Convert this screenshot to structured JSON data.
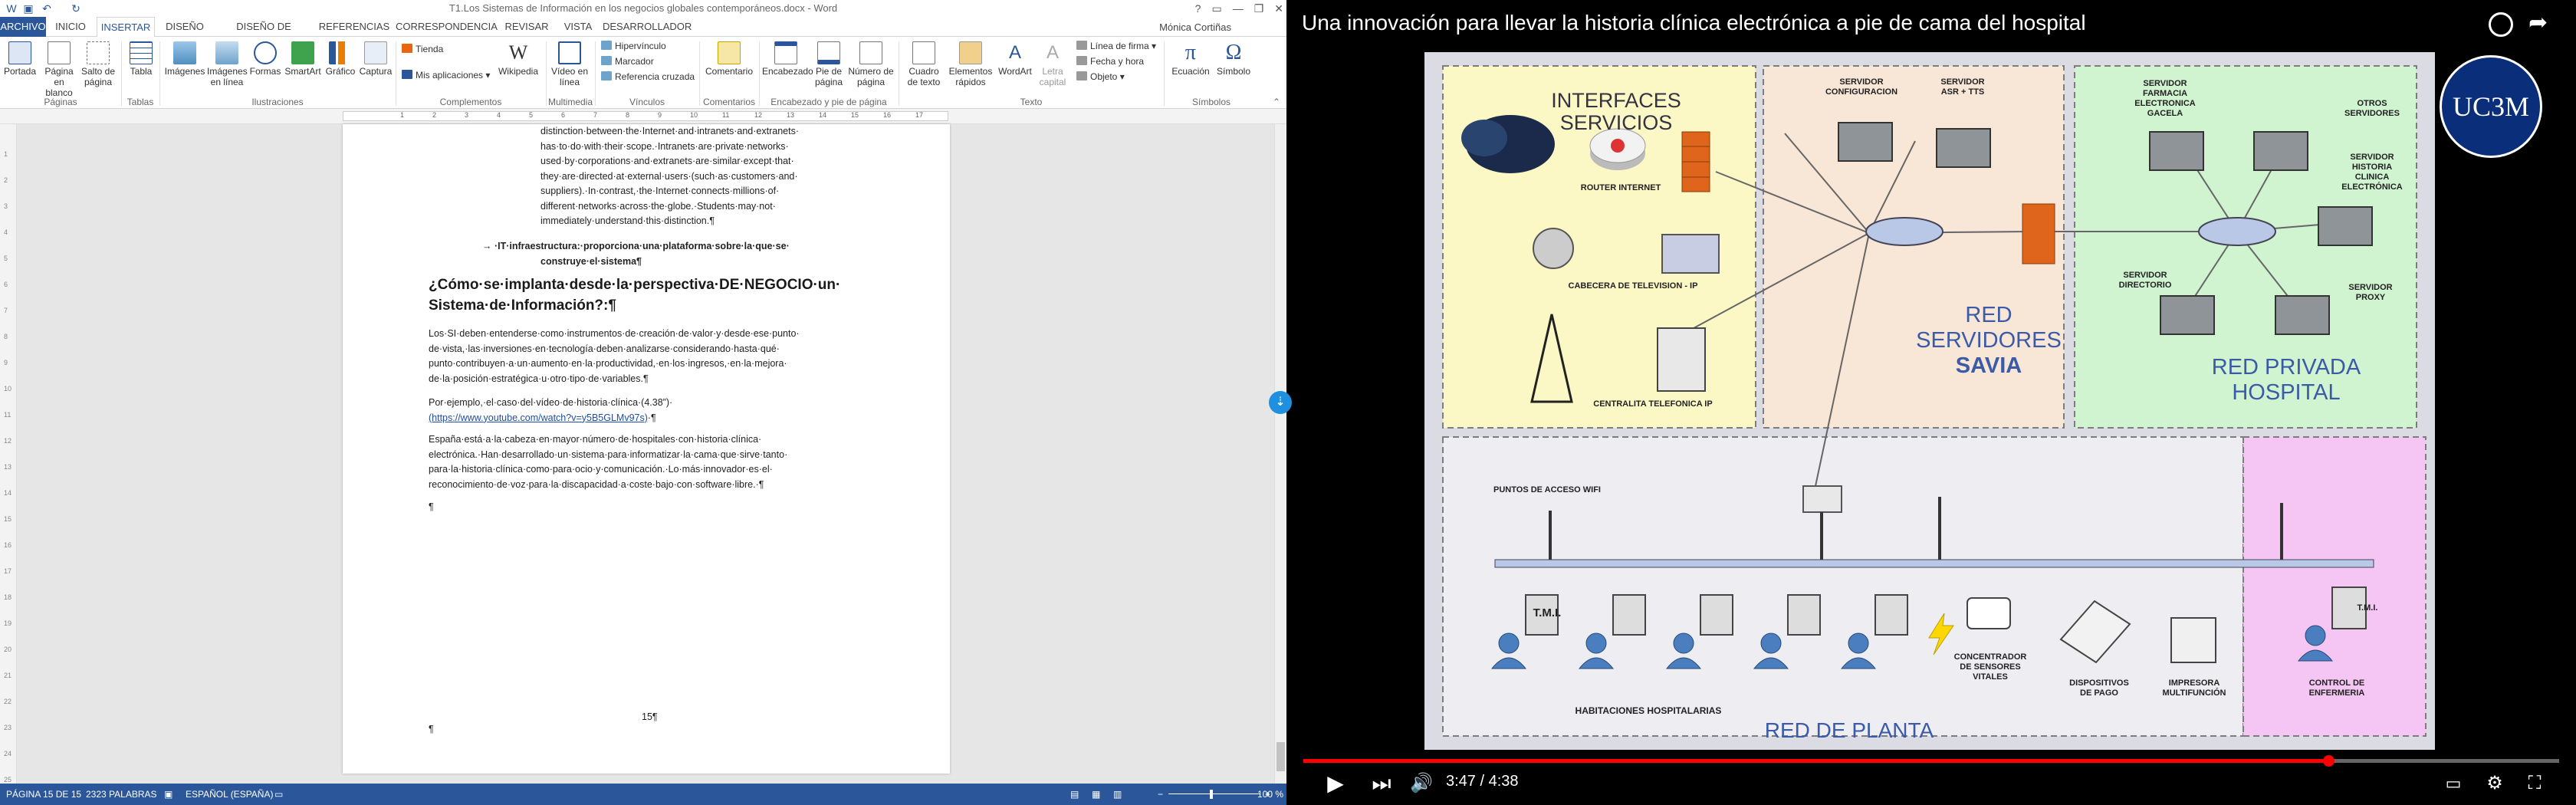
{
  "word": {
    "title": "T1.Los Sistemas de Información en los negocios globales contemporáneos.docx - Word",
    "user": "Mónica Cortiñas",
    "tabs": [
      "ARCHIVO",
      "INICIO",
      "INSERTAR",
      "DISEÑO",
      "DISEÑO DE PÁGINA",
      "REFERENCIAS",
      "CORRESPONDENCIA",
      "REVISAR",
      "VISTA",
      "DESARROLLADOR"
    ],
    "active_tab": "INSERTAR",
    "ribbon": {
      "portada": "Portada",
      "pagina_blanco": "Página en blanco",
      "salto_pagina": "Salto de página",
      "tabla": "Tabla",
      "imagenes": "Imágenes",
      "imagenes_linea": "Imágenes en línea",
      "formas": "Formas",
      "smartart": "SmartArt",
      "grafico": "Gráfico",
      "captura": "Captura",
      "tienda": "Tienda",
      "mis_aplicaciones": "Mis aplicaciones",
      "wikipedia": "Wikipedia",
      "video": "Vídeo en línea",
      "hipervinculo": "Hipervínculo",
      "marcador": "Marcador",
      "ref_cruzada": "Referencia cruzada",
      "comentario": "Comentario",
      "encabezado": "Encabezado",
      "pie_pagina": "Pie de página",
      "numero_pagina": "Número de página",
      "cuadro_texto": "Cuadro de texto",
      "elementos_rapidos": "Elementos rápidos",
      "wordart": "WordArt",
      "letra_capital": "Letra capital",
      "linea_firma": "Línea de firma",
      "fecha_hora": "Fecha y hora",
      "objeto": "Objeto",
      "ecuacion": "Ecuación",
      "simbolo": "Símbolo"
    },
    "groups": [
      "Páginas",
      "Tablas",
      "Ilustraciones",
      "Complementos",
      "Multimedia",
      "Vínculos",
      "Comentarios",
      "Encabezado y pie de página",
      "Texto",
      "Símbolos"
    ],
    "doc": {
      "p1": [
        "distinction·between·the·Internet·and·intranets·and·extranets·",
        "has·to·do·with·their·scope.·Intranets·are·private·networks·",
        "used·by·corporations·and·extranets·are·similar·except·that·",
        "they·are·directed·at·external·users·(such·as·customers·and·",
        "suppliers).·In·contrast,·the·Internet·connects·millions·of·",
        "different·networks·across·the·globe.·Students·may·not·",
        "immediately·understand·this·distinction.¶"
      ],
      "bullet": [
        "→ ·IT·infraestructura:·proporciona·una·plataforma·sobre·la·que·se·",
        "construye·el·sistema¶"
      ],
      "heading": [
        "¿Cómo·se·implanta·desde·la·perspectiva·DE·NEGOCIO·un·",
        "Sistema·de·Información?:¶"
      ],
      "p2": [
        "Los·SI·deben·entenderse·como·instrumentos·de·creación·de·valor·y·desde·ese·punto·",
        "de·vista,·las·inversiones·en·tecnología·deben·analizarse·considerando·hasta·qué·",
        "punto·contribuyen·a·un·aumento·en·la·productividad,·en·los·ingresos,·en·la·mejora·",
        "de·la·posición·estratégica·u·otro·tipo·de·variables.¶"
      ],
      "p3a": "Por·ejemplo,·el·caso·del·vídeo·de·historia·clínica·(4.38”)·",
      "p3link": "(https://www.youtube.com/watch?v=y5B5GLMv97s)",
      "p3end": "·¶",
      "p4": [
        "España·está·a·la·cabeza·en·mayor·número·de·hospitales·con·historia·clínica·",
        "electrónica.·Han·desarrollado·un·sistema·para·informatizar·la·cama·que·sirve·tanto·",
        "para·la·historia·clínica·como·para·ocio·y·comunicación.·Lo·más·innovador·es·el·",
        "reconocimiento·de·voz·para·la·discapacidad·a·coste·bajo·con·software·libre.·¶"
      ],
      "para_mark": "¶",
      "page_num": "15¶",
      "para_mark2": "¶"
    },
    "status": {
      "page": "PÁGINA 15 DE 15",
      "words": "2323 PALABRAS",
      "lang": "ESPAÑOL (ESPAÑA)",
      "zoom": "100 %"
    }
  },
  "video": {
    "title": "Una innovación para llevar la historia clínica electrónica a pie de cama del hospital",
    "logo": "UC3M",
    "time": "3:47 / 4:38",
    "progress": 0.8165,
    "diagram": {
      "interfaces": "INTERFACES SERVICIOS",
      "router": "ROUTER INTERNET",
      "cabecera": "CABECERA DE TELEVISION - IP",
      "centralita": "CENTRALITA TELEFONICA IP",
      "srv_conf": [
        "SERVIDOR",
        "CONFIGURACION"
      ],
      "srv_asr": [
        "SERVIDOR",
        "ASR + TTS"
      ],
      "red_savia": [
        "RED",
        "SERVIDORES",
        "SAVIA"
      ],
      "srv_farmacia": [
        "SERVIDOR",
        "FARMACIA",
        "ELECTRONICA",
        "GACELA"
      ],
      "otros": [
        "OTROS",
        "SERVIDORES"
      ],
      "srv_historia": [
        "SERVIDOR",
        "HISTORIA",
        "CLINICA",
        "ELECTRÓNICA"
      ],
      "srv_directorio": [
        "SERVIDOR",
        "DIRECTORIO"
      ],
      "srv_proxy": [
        "SERVIDOR",
        "PROXY"
      ],
      "red_privada": [
        "RED PRIVADA",
        "HOSPITAL"
      ],
      "wifi": "PUNTOS DE ACCESO WIFI",
      "tmi": "T.M.I.",
      "tmi2": "T.M.I.",
      "habitaciones": "HABITACIONES HOSPITALARIAS",
      "concentrador": [
        "CONCENTRADOR",
        "DE SENSORES",
        "VITALES"
      ],
      "dispositivos": [
        "DISPOSITIVOS",
        "DE PAGO"
      ],
      "impresora": [
        "IMPRESORA",
        "MULTIFUNCIÓN"
      ],
      "control": [
        "CONTROL DE",
        "ENFERMERIA"
      ],
      "red_planta": "RED DE PLANTA"
    }
  },
  "colors": {
    "word_blue": "#2b579a",
    "progress_red": "#ff0000",
    "uc3m_blue": "#0b2e7a"
  }
}
